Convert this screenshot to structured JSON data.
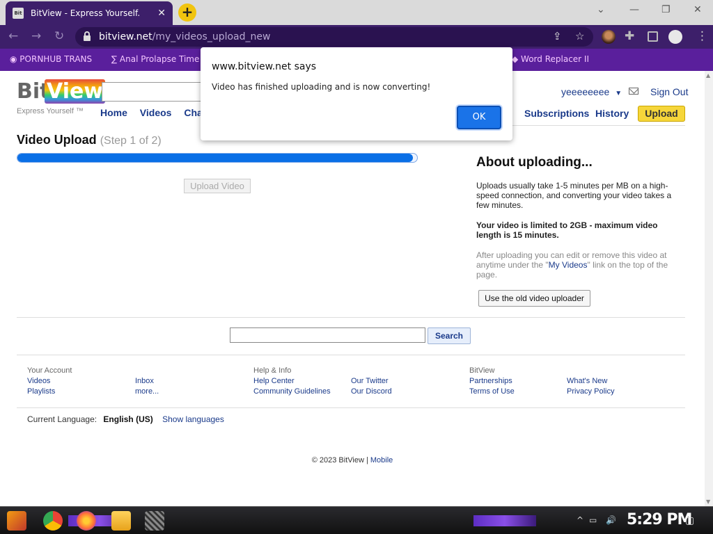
{
  "browser": {
    "tab_title": "BitView - Express Yourself.",
    "tab_favicon": "Bit",
    "close_glyph": "✕",
    "new_tab_glyph": "+",
    "url_host": "bitview.net",
    "url_path": "/my_videos_upload_new",
    "bookmarks": [
      "PORNHUB TRANS",
      "Anal Prolapse Time",
      "Word Replacer II"
    ]
  },
  "site": {
    "logo_bit": "Bit",
    "logo_view": "View",
    "tagline": "Express Yourself ™",
    "nav": [
      "Home",
      "Videos",
      "Chan"
    ],
    "username": "yeeeeeeee",
    "dropdown_glyph": "▼",
    "sign_out": "Sign Out",
    "subscriptions": "Subscriptions",
    "history": "History",
    "upload": "Upload"
  },
  "upload": {
    "title": "Video Upload",
    "step": "(Step 1 of 2)",
    "progress": 0.99,
    "button": "Upload Video"
  },
  "about": {
    "title": "About uploading...",
    "p1": "Uploads usually take 1-5 minutes per MB on a high-speed connection, and converting your video takes a few minutes.",
    "p2": "Your video is limited to 2GB - maximum video length is 15 minutes.",
    "p3_before": "After uploading you can edit or remove this video at anytime under the \"",
    "p3_link": "My Videos",
    "p3_after": "\" link on the top of the page.",
    "old_uploader": "Use the old video uploader"
  },
  "search": {
    "button": "Search"
  },
  "footer": {
    "col1_head": "Your Account",
    "col1_links": [
      "Videos",
      "Playlists"
    ],
    "col2_links": [
      "Inbox",
      "more..."
    ],
    "col3_head": "Help & Info",
    "col3_links": [
      "Help Center",
      "Community Guidelines"
    ],
    "col4_links": [
      "Our Twitter",
      "Our Discord"
    ],
    "col5_head": "BitView",
    "col5_links": [
      "Partnerships",
      "Terms of Use"
    ],
    "col6_links": [
      "What's New",
      "Privacy Policy"
    ],
    "language_label": "Current Language:",
    "language_value": "English (US)",
    "show_languages": "Show languages",
    "copyright": "© 2023 BitView",
    "separator": "|",
    "mobile": "Mobile"
  },
  "dialog": {
    "title": "www.bitview.net says",
    "message": "Video has finished uploading and is now converting!",
    "ok": "OK"
  },
  "taskbar": {
    "clock": "5:29 PM"
  },
  "colors": {
    "chrome_purple": "#3d1f6a",
    "bookmarks_bar": "#5a1f9c",
    "link_blue": "#1a3a8a",
    "progress_blue": "#0a6fe6",
    "upload_yellow": "#f6d63a"
  },
  "icons": [
    "back-icon",
    "forward-icon",
    "reload-icon",
    "lock-icon",
    "share-icon",
    "star-icon",
    "extensions-icon",
    "sidepanel-icon",
    "profile-icon",
    "mail-icon",
    "windows-start-icon",
    "chrome-icon",
    "firefox-icon",
    "folder-icon",
    "speaker-icon",
    "network-icon",
    "notifications-icon"
  ]
}
